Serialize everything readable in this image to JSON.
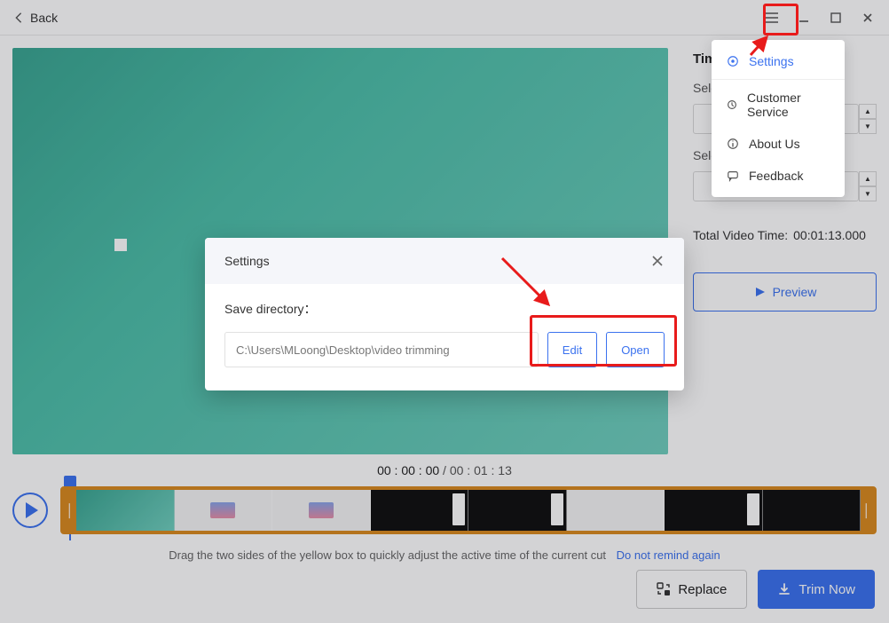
{
  "titlebar": {
    "back": "Back"
  },
  "side": {
    "title": "Time",
    "start_label": "Select start time",
    "end_label": "Select end time",
    "total_label": "Total Video Time:",
    "total_value": "00:01:13.000",
    "preview": "Preview"
  },
  "timecode": {
    "current": "00 : 00 : 00",
    "total": "00 : 01 : 13"
  },
  "hint": {
    "text": "Drag the two sides of the yellow box to quickly adjust the active time of the current cut",
    "link": "Do not remind again"
  },
  "footer": {
    "replace": "Replace",
    "trim": "Trim Now"
  },
  "menu": {
    "settings": "Settings",
    "customer": "Customer Service",
    "about": "About Us",
    "feedback": "Feedback"
  },
  "modal": {
    "title": "Settings",
    "label": "Save directory：",
    "path": "C:\\Users\\MLoong\\Desktop\\video trimming",
    "edit": "Edit",
    "open": "Open"
  }
}
